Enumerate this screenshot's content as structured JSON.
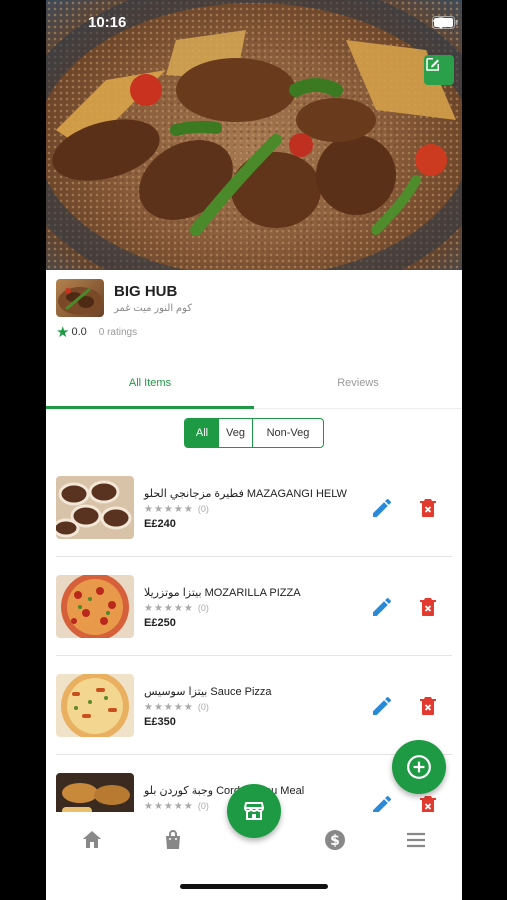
{
  "status_bar": {
    "time": "10:16"
  },
  "restaurant": {
    "name": "BIG HUB",
    "address": "كوم النور ميت غمر",
    "rating": "0.0",
    "ratings_count": "0 ratings"
  },
  "tabs": [
    {
      "label": "All Items",
      "active": true
    },
    {
      "label": "Reviews",
      "active": false
    }
  ],
  "filter": {
    "all": "All",
    "veg": "Veg",
    "nonveg": "Non-Veg",
    "selected": "All"
  },
  "items": [
    {
      "name": "فطيرة مزجانجي الحلو MAZAGANGI HELW",
      "rating_count": "(0)",
      "price": "E£240"
    },
    {
      "name": "بيتزا موتزريلا MOZARILLA PIZZA",
      "rating_count": "(0)",
      "price": "E£250"
    },
    {
      "name": "بيتزا سوسيس Sauce Pizza",
      "rating_count": "(0)",
      "price": "E£350"
    },
    {
      "name": "وجبة كوردن بلو Cordon Bleu Meal",
      "rating_count": "(0)",
      "price": ""
    }
  ],
  "colors": {
    "accent": "#1e9a44",
    "edit": "#2a8ad8",
    "delete": "#e23a2e"
  },
  "icons": {
    "edit_cover": "edit-square-icon",
    "nav": [
      "home-icon",
      "shopping-bag-icon",
      "store-icon",
      "dollar-icon",
      "menu-icon"
    ],
    "add": "add-circle-icon"
  }
}
